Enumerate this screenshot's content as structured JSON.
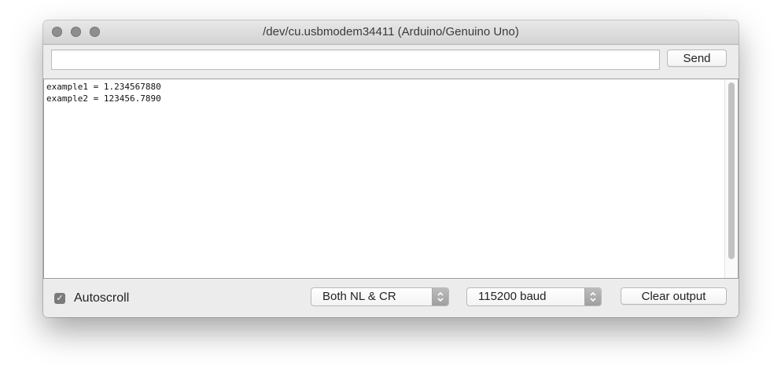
{
  "window": {
    "title": "/dev/cu.usbmodem34411 (Arduino/Genuino Uno)"
  },
  "input": {
    "value": "",
    "placeholder": ""
  },
  "toolbar": {
    "send_label": "Send",
    "clear_label": "Clear output"
  },
  "output": {
    "lines": [
      "example1 = 1.234567880",
      "example2 = 123456.7890"
    ]
  },
  "footer": {
    "autoscroll_label": "Autoscroll",
    "autoscroll_checked": true,
    "line_ending": "Both NL & CR",
    "baud_rate": "115200 baud"
  },
  "icons": {
    "window_controls": [
      "close-icon",
      "minimize-icon",
      "zoom-icon"
    ],
    "checkbox": "checkmark-icon",
    "select": "updown-chevron-icon"
  },
  "colors": {
    "window_bg": "#ececec",
    "traffic_light_inactive": "#8e8e8e",
    "checkbox_fill": "#7b7b7b",
    "scroll_thumb": "#c1c1c1"
  }
}
